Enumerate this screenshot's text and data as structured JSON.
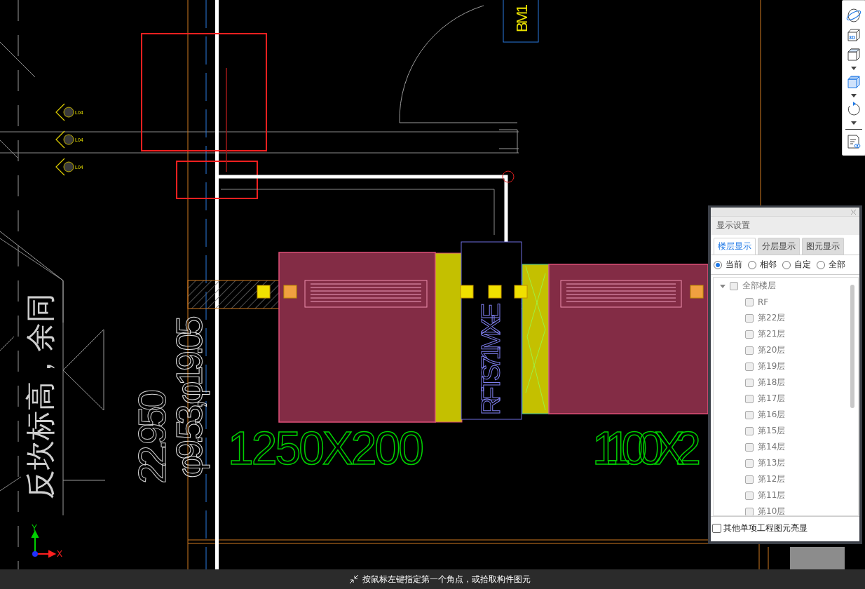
{
  "drawing": {
    "tag_labels": [
      "L04",
      "L04",
      "L04"
    ],
    "equipment_label": "BM1",
    "note_text": "反坎标高，余同",
    "elevation_text": "22.950",
    "pipe_size_text": "φ9.53,φ19.05",
    "unit_label": "RFTS71MX-E",
    "duct_sizes": [
      "1250X200",
      "1100X2"
    ],
    "axis_labels": {
      "y": "Y",
      "x": "X"
    }
  },
  "view_toolbar": {
    "items": [
      {
        "kind": "orbit",
        "dropdown": false
      },
      {
        "kind": "view3d",
        "label": "3D",
        "dropdown": false
      },
      {
        "kind": "cube",
        "dropdown": true
      },
      {
        "kind": "cube-filled",
        "dropdown": true
      },
      {
        "kind": "rotate",
        "dropdown": true
      },
      {
        "kind": "settings",
        "dropdown": false
      }
    ]
  },
  "display_panel": {
    "title": "显示设置",
    "tabs": [
      {
        "label": "楼层显示",
        "selected": true
      },
      {
        "label": "分层显示",
        "selected": false
      },
      {
        "label": "图元显示",
        "selected": false
      }
    ],
    "scope_options": [
      {
        "label": "当前",
        "selected": true
      },
      {
        "label": "相邻",
        "selected": false
      },
      {
        "label": "自定",
        "selected": false
      },
      {
        "label": "全部",
        "selected": false
      }
    ],
    "floors": [
      {
        "label": "全部楼层",
        "checked": false,
        "expanded": true,
        "children": [
          {
            "label": "RF",
            "checked": false
          },
          {
            "label": "第22层",
            "checked": false
          },
          {
            "label": "第21层",
            "checked": false
          },
          {
            "label": "第20层",
            "checked": false
          },
          {
            "label": "第19层",
            "checked": false
          },
          {
            "label": "第18层",
            "checked": false
          },
          {
            "label": "第17层",
            "checked": false
          },
          {
            "label": "第16层",
            "checked": false
          },
          {
            "label": "第15层",
            "checked": false
          },
          {
            "label": "第14层",
            "checked": false
          },
          {
            "label": "第13层",
            "checked": false
          },
          {
            "label": "第12层",
            "checked": false
          },
          {
            "label": "第11层",
            "checked": false
          },
          {
            "label": "第10层",
            "checked": false
          }
        ]
      }
    ],
    "highlight_option": {
      "label": "其他单项工程图元亮显",
      "checked": false
    }
  },
  "status_bar": {
    "prompt": "按鼠标左键指定第一个角点，或拾取构件图元"
  }
}
